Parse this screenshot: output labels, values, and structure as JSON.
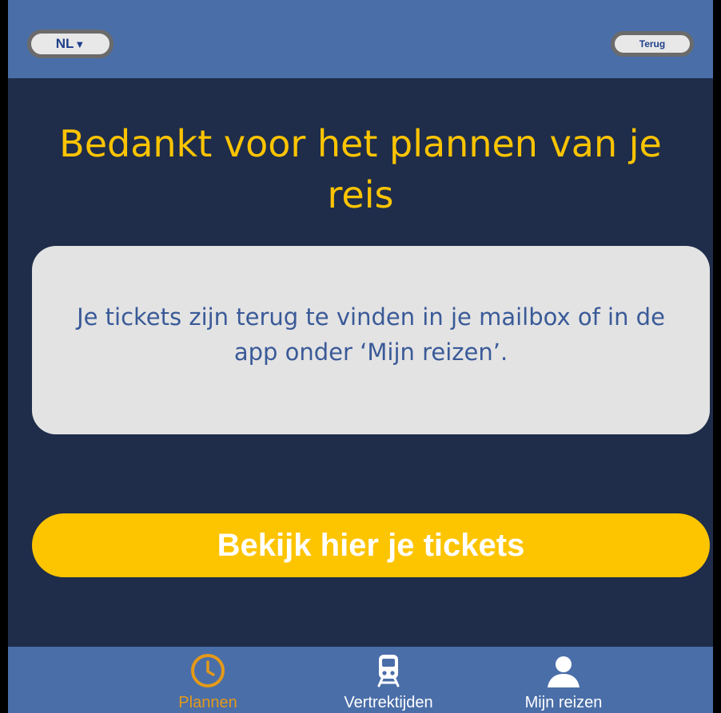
{
  "header": {
    "language_label": "NL",
    "language_caret": "▼",
    "back_label": "Terug"
  },
  "main": {
    "title": "Bedankt voor het plannen van je reis",
    "info_text": "Je tickets zijn terug te vinden in je mailbox of in de app onder ‘Mijn reizen’.",
    "cta_label": "Bekijk hier je tickets"
  },
  "tabbar": {
    "items": [
      {
        "label": "Plannen",
        "icon": "clock-icon",
        "active": true
      },
      {
        "label": "Vertrektijden",
        "icon": "train-icon",
        "active": false
      },
      {
        "label": "Mijn reizen",
        "icon": "user-icon",
        "active": false
      }
    ]
  },
  "colors": {
    "background": "#1f2d4a",
    "bars": "#4a6ea8",
    "accent_yellow": "#fdc400",
    "active_tab": "#e39a1a",
    "card": "#e3e3e3",
    "info_text": "#3a5a98"
  }
}
